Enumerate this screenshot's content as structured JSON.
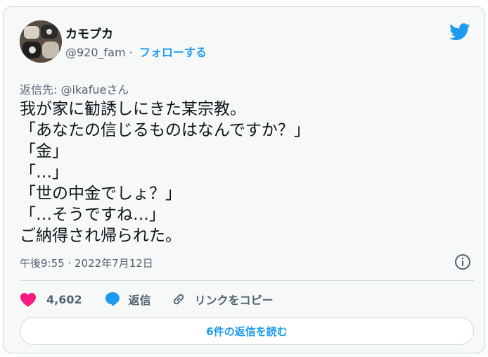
{
  "author": {
    "display_name": "カモプカ",
    "handle": "@920_fam",
    "separator": "·",
    "follow_label": "フォローする"
  },
  "reply_to": "返信先: @ikafueさん",
  "tweet": {
    "lines": [
      "我が家に勧誘しにきた某宗教。",
      "「あなたの信じるものはなんですか？」",
      "「金」",
      "「…」",
      "「世の中金でしょ？」",
      "「…そうですね…」",
      "ご納得され帰られた。"
    ],
    "timestamp": "午後9:55 · 2022年7月12日"
  },
  "actions": {
    "like_count": "4,602",
    "reply_label": "返信",
    "copy_link_label": "リンクをコピー"
  },
  "read_replies_label": "6件の返信を読む",
  "icons": {
    "brand": "twitter-bird-icon",
    "info": "info-icon",
    "like": "heart-icon",
    "reply": "speech-bubble-icon",
    "link": "link-icon"
  },
  "colors": {
    "accent": "#1d9bf0",
    "like": "#f91880",
    "muted": "#536471",
    "text": "#0f1419",
    "card_bg": "#f7f9f9",
    "border": "#cfd9de"
  }
}
